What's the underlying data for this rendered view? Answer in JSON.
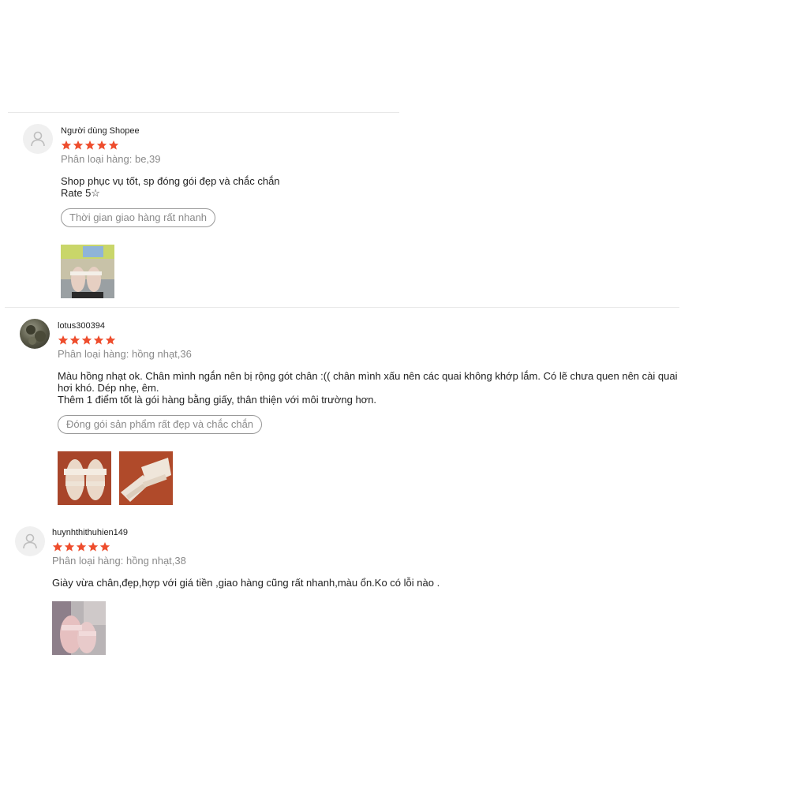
{
  "reviews": [
    {
      "username": "Người dùng Shopee",
      "rating": 5,
      "variant": "Phân loại hàng: be,39",
      "comment": "Shop phục vụ tốt, sp đóng gói đẹp và chắc chắn\nRate 5☆",
      "tag": "Thời gian giao hàng rất nhanh",
      "avatar": "default-user-icon"
    },
    {
      "username": "lotus300394",
      "rating": 5,
      "variant": "Phân loại hàng: hồng nhạt,36",
      "comment": "Màu hồng nhạt ok. Chân mình ngắn nên bị rộng gót chân :(( chân mình xấu nên các quai không khớp lắm. Có lẽ chưa quen nên cài quai hơi khó. Dép nhẹ, êm.\nThêm 1 điểm tốt là gói hàng bằng giấy, thân thiện với môi trường hơn.",
      "tag": "Đóng gói sản phẩm rất đẹp và chắc chắn",
      "avatar": "user-photo"
    },
    {
      "username": "huynhthithuhien149",
      "rating": 5,
      "variant": "Phân loại hàng: hồng nhạt,38",
      "comment": "Giày vừa chân,đẹp,hợp với giá tiền ,giao hàng cũng rất nhanh,màu ổn.Ko có lỗi nào .",
      "avatar": "default-user-icon"
    }
  ],
  "colors": {
    "star": "#ee4d2d",
    "muted_text": "#8a8a8a",
    "divider": "#e8e8e8"
  }
}
